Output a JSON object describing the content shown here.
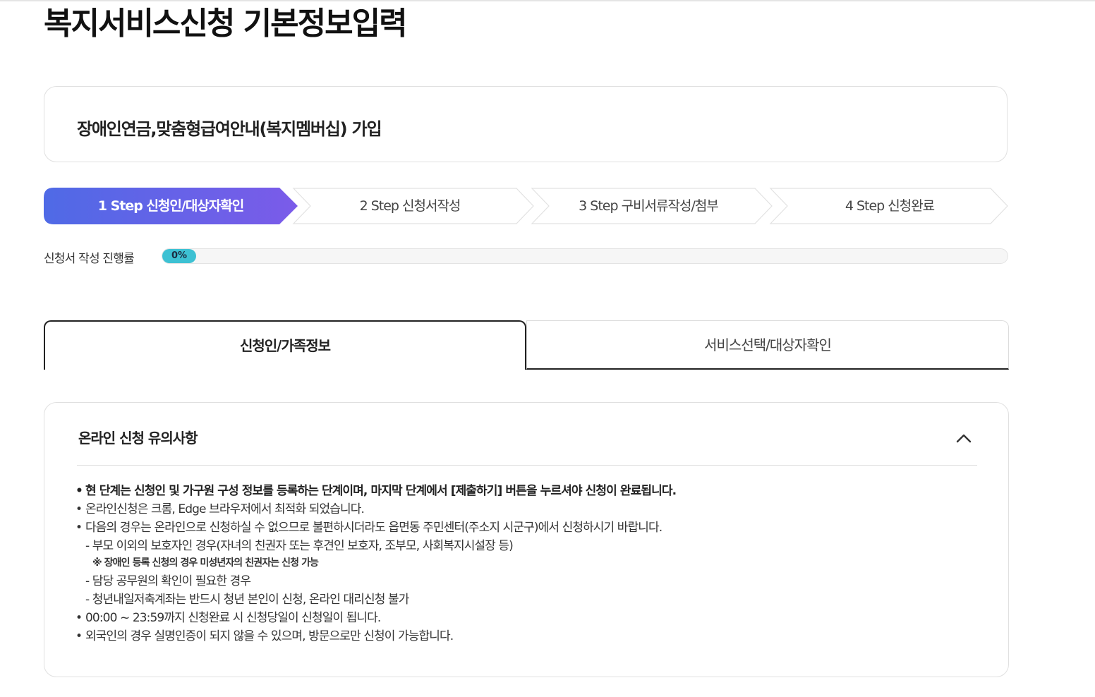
{
  "page": {
    "title": "복지서비스신청 기본정보입력"
  },
  "service": {
    "name": "장애인연금,맞춤형급여안내(복지멤버십) 가입"
  },
  "steps": [
    {
      "label": "1 Step 신청인/대상자확인",
      "active": true
    },
    {
      "label": "2 Step 신청서작성",
      "active": false
    },
    {
      "label": "3 Step 구비서류작성/첨부",
      "active": false
    },
    {
      "label": "4 Step 신청완료",
      "active": false
    }
  ],
  "progress": {
    "label": "신청서 작성 진행률",
    "value_text": "0%",
    "value": 0
  },
  "tabs": [
    {
      "label": "신청인/가족정보",
      "selected": true
    },
    {
      "label": "서비스선택/대상자확인",
      "selected": false
    }
  ],
  "notice": {
    "title": "온라인 신청 유의사항",
    "lines": [
      {
        "bullet": "•",
        "text": "현 단계는 신청인 및 가구원 구성 정보를 등록하는 단계이며, 마지막 단계에서 [제출하기] 버튼을 누르셔야 신청이 완료됩니다."
      },
      {
        "bullet": "•",
        "text": "온라인신청은 크롬, Edge 브라우저에서 최적화 되었습니다."
      },
      {
        "bullet": "•",
        "text": "다음의 경우는 온라인으로 신청하실 수 없으므로 불편하시더라도 읍면동 주민센터(주소지 시군구)에서 신청하시기 바랍니다."
      },
      {
        "text": "- 부모 이외의 보호자인 경우(자녀의 친권자 또는 후견인 보호자, 조부모, 사회복지시설장 등)"
      },
      {
        "text": "※ 장애인 등록 신청의 경우 미성년자의 친권자는 신청 가능"
      },
      {
        "text": "- 담당 공무원의 확인이 필요한 경우"
      },
      {
        "text": "- 청년내일저축계좌는 반드시 청년 본인이 신청, 온라인 대리신청 불가"
      },
      {
        "bullet": "•",
        "text": "00:00 ~ 23:59까지 신청완료 시 신청당일이 신청일이 됩니다."
      },
      {
        "bullet": "•",
        "text": "외국인의 경우 실명인증이 되지 않을 수 있으며, 방문으로만 신청이 가능합니다."
      }
    ]
  },
  "colors": {
    "step_active_start": "#4f6ae6",
    "step_active_end": "#7b5be9",
    "progress_chip": "#3dc1d3",
    "border": "#e0e0e0"
  },
  "icons": {
    "collapse": "chevron-up-icon"
  }
}
